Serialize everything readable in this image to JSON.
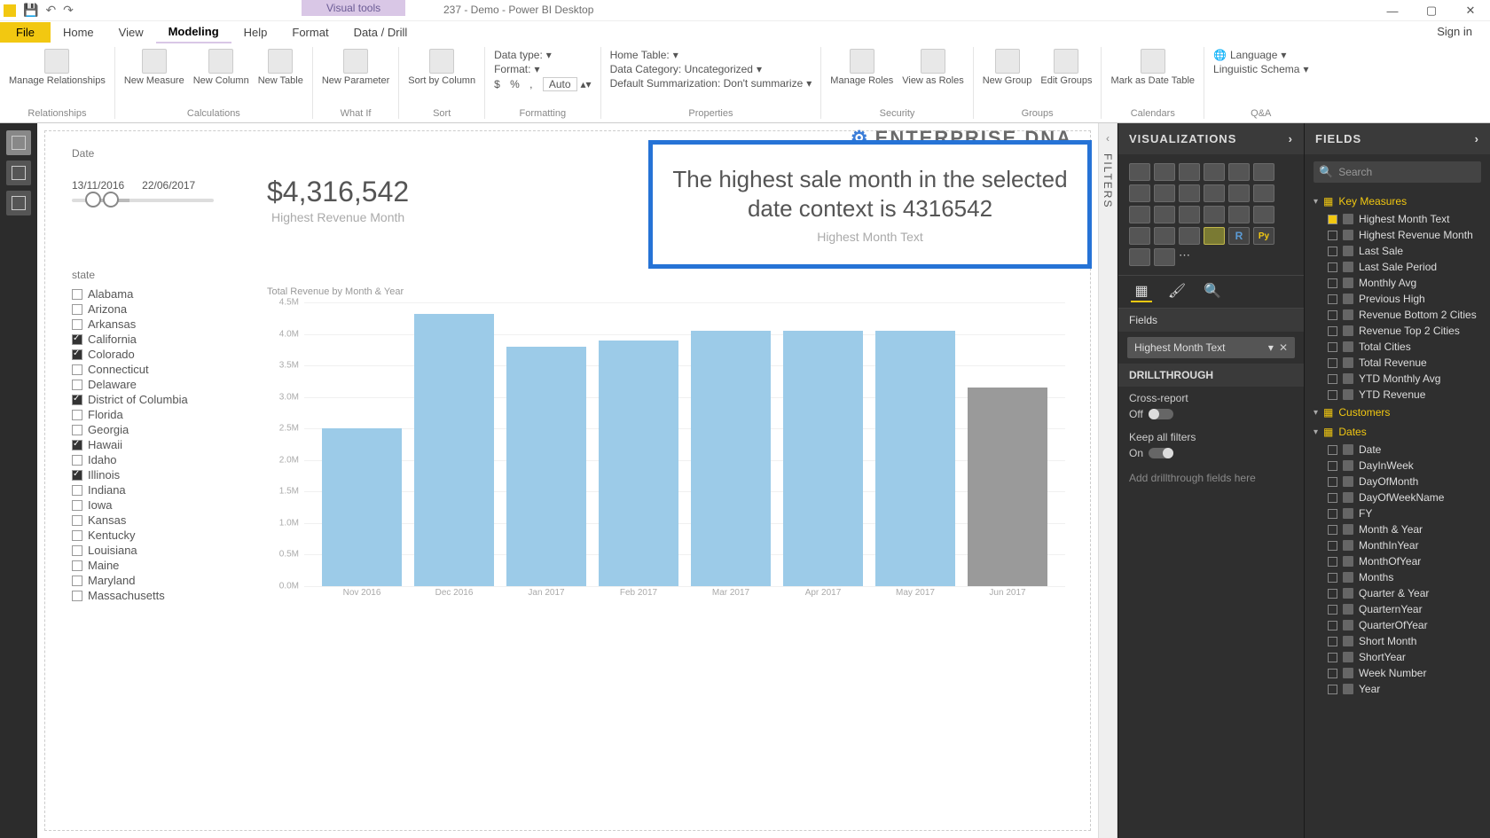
{
  "title": "237 - Demo - Power BI Desktop",
  "visualTools": "Visual tools",
  "signin": "Sign in",
  "tabs": {
    "file": "File",
    "home": "Home",
    "view": "View",
    "modeling": "Modeling",
    "help": "Help",
    "format": "Format",
    "datadrill": "Data / Drill"
  },
  "ribbon": {
    "relationships": {
      "manage": "Manage\nRelationships",
      "group": "Relationships"
    },
    "calculations": {
      "measure": "New\nMeasure",
      "column": "New\nColumn",
      "table": "New\nTable",
      "group": "Calculations"
    },
    "whatif": {
      "param": "New\nParameter",
      "group": "What If"
    },
    "sort": {
      "sortby": "Sort by\nColumn",
      "group": "Sort"
    },
    "formatting": {
      "datatype": "Data type:",
      "format": "Format:",
      "auto": "Auto",
      "group": "Formatting",
      "currency": "$",
      "percent": "%",
      "comma": ","
    },
    "properties": {
      "hometable": "Home Table:",
      "datacat": "Data Category: Uncategorized",
      "summ": "Default Summarization: Don't summarize",
      "group": "Properties"
    },
    "security": {
      "manage": "Manage\nRoles",
      "viewas": "View as\nRoles",
      "group": "Security"
    },
    "groups": {
      "new": "New\nGroup",
      "edit": "Edit\nGroups",
      "group": "Groups"
    },
    "calendars": {
      "mark": "Mark as\nDate Table",
      "group": "Calendars"
    },
    "qa": {
      "lang": "Language",
      "ling": "Linguistic Schema",
      "group": "Q&A"
    }
  },
  "dateSlicer": {
    "title": "Date",
    "from": "13/11/2016",
    "to": "22/06/2017"
  },
  "revCard": {
    "value": "$4,316,542",
    "caption": "Highest Revenue Month"
  },
  "textCard": {
    "message": "The highest sale month in the selected date context is 4316542",
    "caption": "Highest Month Text"
  },
  "logo": "ENTERPRISE DNA",
  "stateSlicer": {
    "title": "state",
    "items": [
      {
        "label": "Alabama",
        "checked": false
      },
      {
        "label": "Arizona",
        "checked": false
      },
      {
        "label": "Arkansas",
        "checked": false
      },
      {
        "label": "California",
        "checked": true
      },
      {
        "label": "Colorado",
        "checked": true
      },
      {
        "label": "Connecticut",
        "checked": false
      },
      {
        "label": "Delaware",
        "checked": false
      },
      {
        "label": "District of Columbia",
        "checked": true
      },
      {
        "label": "Florida",
        "checked": false
      },
      {
        "label": "Georgia",
        "checked": false
      },
      {
        "label": "Hawaii",
        "checked": true
      },
      {
        "label": "Idaho",
        "checked": false
      },
      {
        "label": "Illinois",
        "checked": true
      },
      {
        "label": "Indiana",
        "checked": false
      },
      {
        "label": "Iowa",
        "checked": false
      },
      {
        "label": "Kansas",
        "checked": false
      },
      {
        "label": "Kentucky",
        "checked": false
      },
      {
        "label": "Louisiana",
        "checked": false
      },
      {
        "label": "Maine",
        "checked": false
      },
      {
        "label": "Maryland",
        "checked": false
      },
      {
        "label": "Massachusetts",
        "checked": false
      }
    ]
  },
  "chart_data": {
    "type": "bar",
    "title": "Total Revenue by Month & Year",
    "categories": [
      "Nov 2016",
      "Dec 2016",
      "Jan 2017",
      "Feb 2017",
      "Mar 2017",
      "Apr 2017",
      "May 2017",
      "Jun 2017"
    ],
    "values": [
      2500000,
      4316542,
      3800000,
      3900000,
      4050000,
      4050000,
      4050000,
      3150000
    ],
    "y_ticks": [
      "4.5M",
      "4.0M",
      "3.5M",
      "3.0M",
      "2.5M",
      "2.0M",
      "1.5M",
      "1.0M",
      "0.5M",
      "0.0M"
    ],
    "ylim": [
      0,
      4500000
    ],
    "highlight_last": true
  },
  "filtersLabel": "FILTERS",
  "vizPane": {
    "header": "VISUALIZATIONS",
    "fieldsSection": "Fields",
    "fieldWell": "Highest Month Text",
    "drillHeader": "DRILLTHROUGH",
    "crossReport": "Cross-report",
    "off": "Off",
    "keepFilters": "Keep all filters",
    "on": "On",
    "dropHint": "Add drillthrough fields here"
  },
  "fieldsPane": {
    "header": "FIELDS",
    "searchPlaceholder": "Search",
    "groups": [
      {
        "name": "Key Measures",
        "open": true,
        "fields": [
          {
            "label": "Highest Month Text",
            "checked": true
          },
          {
            "label": "Highest Revenue Month",
            "checked": false
          },
          {
            "label": "Last Sale",
            "checked": false
          },
          {
            "label": "Last Sale Period",
            "checked": false
          },
          {
            "label": "Monthly Avg",
            "checked": false
          },
          {
            "label": "Previous High",
            "checked": false
          },
          {
            "label": "Revenue Bottom 2 Cities",
            "checked": false
          },
          {
            "label": "Revenue Top 2 Cities",
            "checked": false
          },
          {
            "label": "Total Cities",
            "checked": false
          },
          {
            "label": "Total Revenue",
            "checked": false
          },
          {
            "label": "YTD Monthly Avg",
            "checked": false
          },
          {
            "label": "YTD Revenue",
            "checked": false
          }
        ]
      },
      {
        "name": "Customers",
        "open": false,
        "fields": []
      },
      {
        "name": "Dates",
        "open": true,
        "fields": [
          {
            "label": "Date",
            "checked": false
          },
          {
            "label": "DayInWeek",
            "checked": false
          },
          {
            "label": "DayOfMonth",
            "checked": false
          },
          {
            "label": "DayOfWeekName",
            "checked": false
          },
          {
            "label": "FY",
            "checked": false
          },
          {
            "label": "Month & Year",
            "checked": false
          },
          {
            "label": "MonthInYear",
            "checked": false
          },
          {
            "label": "MonthOfYear",
            "checked": false
          },
          {
            "label": "Months",
            "checked": false
          },
          {
            "label": "Quarter & Year",
            "checked": false
          },
          {
            "label": "QuarternYear",
            "checked": false
          },
          {
            "label": "QuarterOfYear",
            "checked": false
          },
          {
            "label": "Short Month",
            "checked": false
          },
          {
            "label": "ShortYear",
            "checked": false
          },
          {
            "label": "Week Number",
            "checked": false
          },
          {
            "label": "Year",
            "checked": false
          }
        ]
      }
    ]
  }
}
